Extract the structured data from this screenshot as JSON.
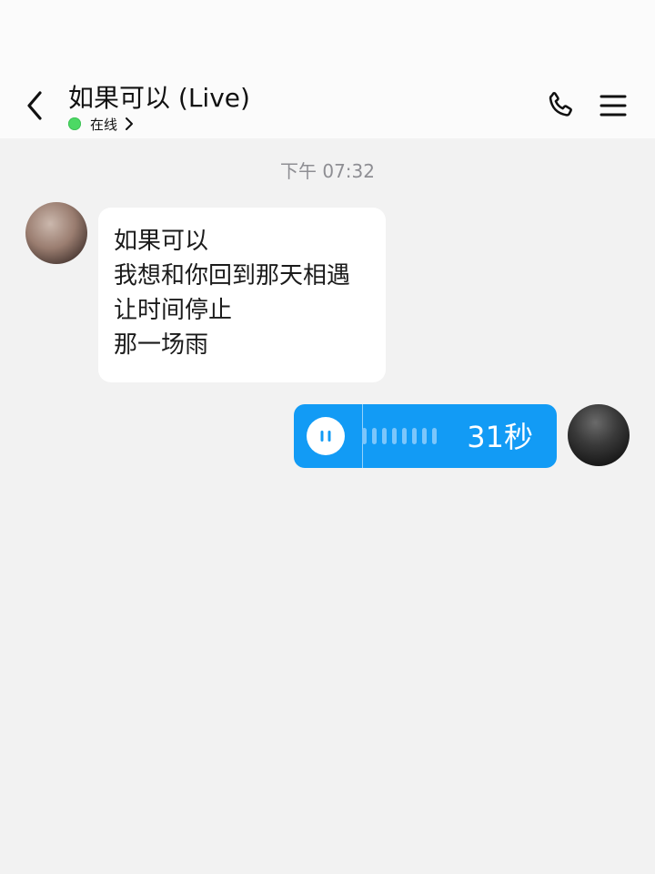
{
  "header": {
    "title": "如果可以 (Live)",
    "status": "在线",
    "status_color": "#4cd964"
  },
  "chat": {
    "timestamp": "下午 07:32",
    "messages": [
      {
        "sender": "other",
        "type": "text",
        "lines": [
          "如果可以",
          "我想和你回到那天相遇",
          "让时间停止",
          "那一场雨"
        ]
      },
      {
        "sender": "self",
        "type": "voice",
        "duration_label": "31秒",
        "state": "playing"
      }
    ]
  },
  "colors": {
    "voice_bubble": "#129bf5",
    "background": "#f2f2f2",
    "text_bubble": "#ffffff"
  },
  "icons": [
    "back-icon",
    "chevron-right-icon",
    "phone-icon",
    "menu-icon",
    "pause-icon"
  ]
}
